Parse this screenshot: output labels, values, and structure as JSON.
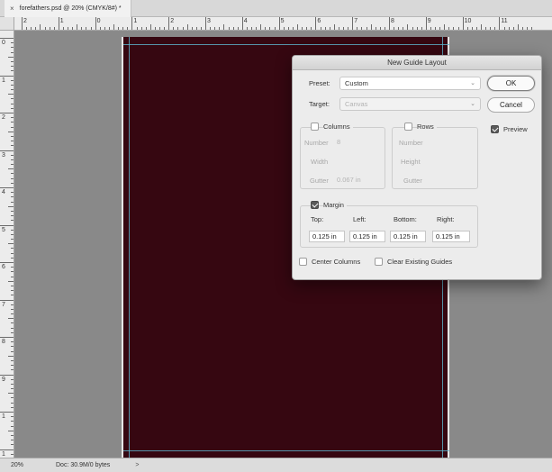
{
  "document": {
    "tab_close": "×",
    "tab_title": "forefathers.psd @ 20% (CMYK/8#) *"
  },
  "ruler": {
    "h_labels": [
      "2",
      "1",
      "0",
      "1",
      "2",
      "3",
      "4",
      "5",
      "6",
      "7",
      "8",
      "9",
      "10",
      "11"
    ],
    "v_labels": [
      "0",
      "1",
      "2",
      "3",
      "4",
      "5",
      "6",
      "7",
      "8",
      "9",
      "1",
      "1"
    ]
  },
  "dialog": {
    "title": "New Guide Layout",
    "preset_label": "Preset:",
    "preset_value": "Custom",
    "target_label": "Target:",
    "target_value": "Canvas",
    "columns_label": "Columns",
    "columns_checked": false,
    "columns_number_label": "Number",
    "columns_number_value": "8",
    "columns_width_label": "Width",
    "columns_width_value": "",
    "columns_gutter_label": "Gutter",
    "columns_gutter_value": "0.067 in",
    "rows_label": "Rows",
    "rows_checked": false,
    "rows_number_label": "Number",
    "rows_height_label": "Height",
    "rows_gutter_label": "Gutter",
    "margin_label": "Margin",
    "margin_checked": true,
    "margin_top_label": "Top:",
    "margin_left_label": "Left:",
    "margin_bottom_label": "Bottom:",
    "margin_right_label": "Right:",
    "margin_top_value": "0.125 in",
    "margin_left_value": "0.125 in",
    "margin_bottom_value": "0.125 in",
    "margin_right_value": "0.125 in",
    "center_columns_label": "Center Columns",
    "center_columns_checked": false,
    "clear_guides_label": "Clear Existing Guides",
    "clear_guides_checked": false,
    "ok_label": "OK",
    "cancel_label": "Cancel",
    "preview_label": "Preview",
    "preview_checked": true
  },
  "status": {
    "zoom": "20%",
    "doc_size": "Doc: 30.9M/0 bytes",
    "arrow": ">"
  },
  "colors": {
    "artboard": "#360711",
    "guide": "#5fb7d0",
    "pasteboard": "#898989"
  }
}
